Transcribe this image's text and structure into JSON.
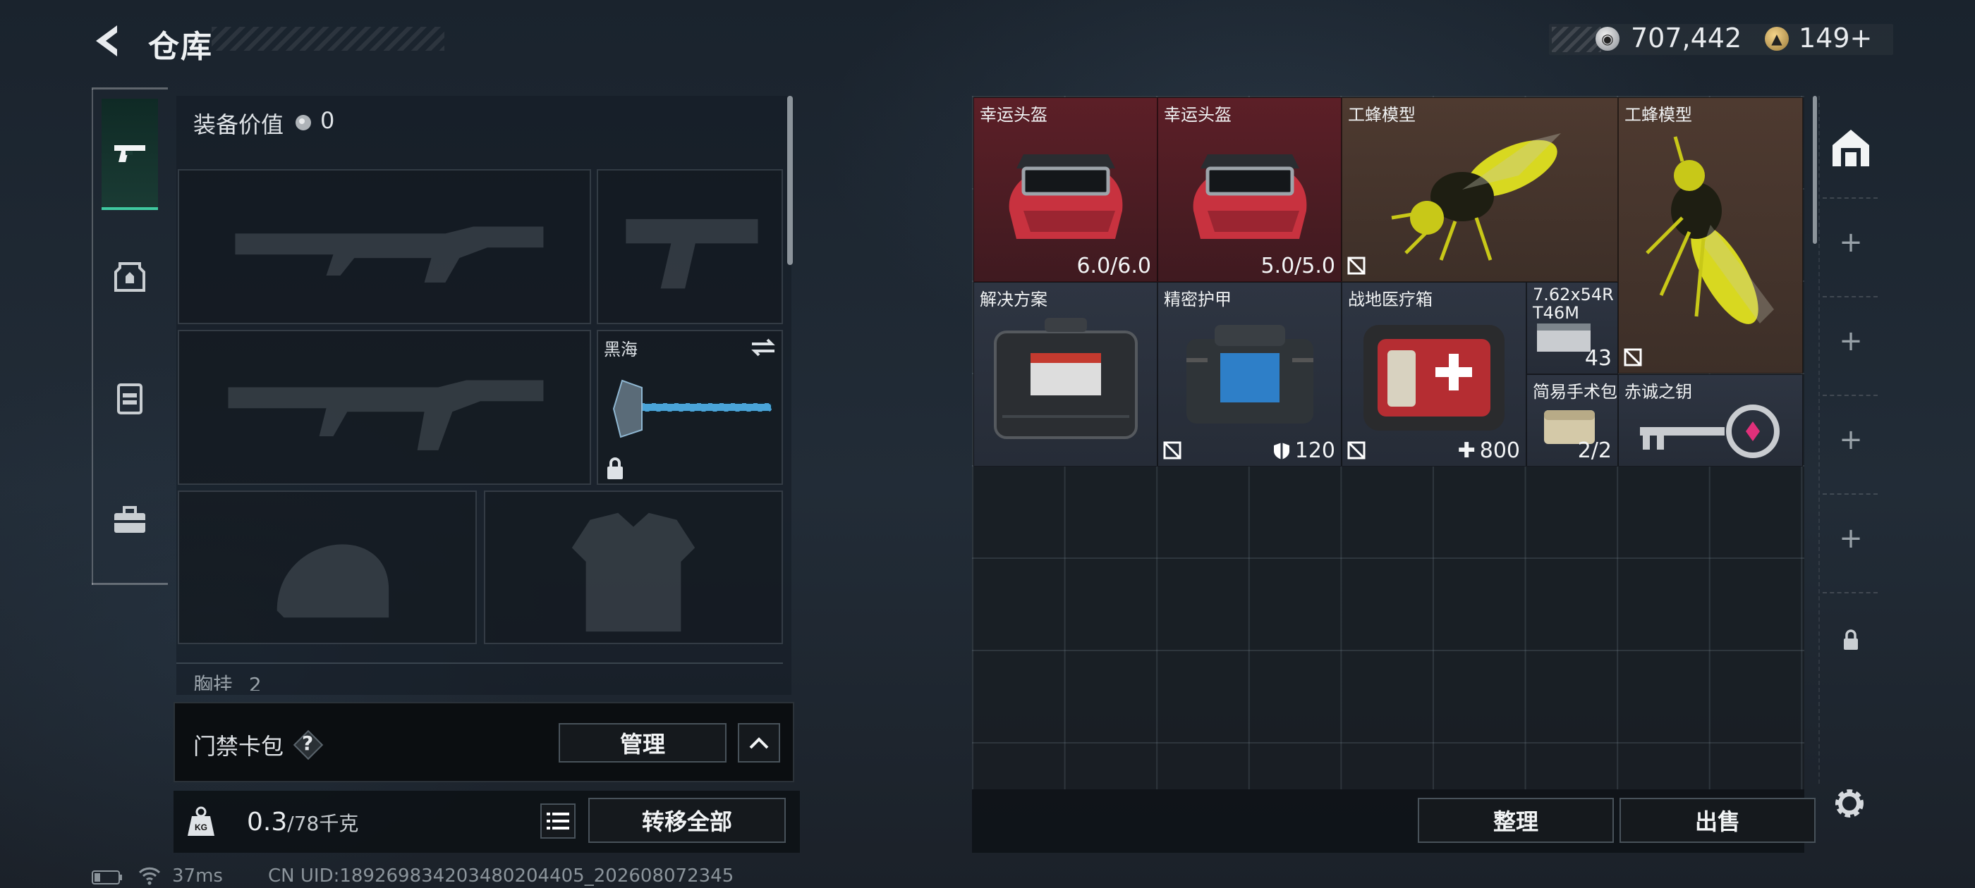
{
  "header": {
    "title": "仓库",
    "silver_amount": "707,442",
    "gold_amount": "149+"
  },
  "sidebar": {
    "items": [
      "pistol-icon",
      "armor-icon",
      "backpack-icon",
      "toolbox-icon"
    ]
  },
  "equipment": {
    "value_label": "装备价值",
    "value": "0",
    "melee_slot_name": "黑海",
    "chest_label": "胸挂",
    "chest_count": "2"
  },
  "card_pack": {
    "label": "门禁卡包",
    "help": "?",
    "manage_label": "管理"
  },
  "bottom": {
    "weight_value": "0.3",
    "weight_unit": "/78千克",
    "transfer_all_label": "转移全部"
  },
  "stash": {
    "items": [
      {
        "name": "幸运头盔",
        "value": "6.0/6.0"
      },
      {
        "name": "幸运头盔",
        "value": "5.0/5.0"
      },
      {
        "name": "工蜂模型",
        "value": ""
      },
      {
        "name": "工蜂模型",
        "value": ""
      },
      {
        "name": "解决方案",
        "value": ""
      },
      {
        "name": "精密护甲",
        "value": "120"
      },
      {
        "name": "战地医疗箱",
        "value": "800"
      },
      {
        "name": "7.62x54R T46M",
        "value": "43"
      },
      {
        "name": "简易手术包",
        "value": "2/2"
      },
      {
        "name": "赤诚之钥",
        "value": ""
      }
    ],
    "sort_label": "整理",
    "sell_label": "出售"
  },
  "status": {
    "ping": "37ms",
    "uid": "CN UID:18926983420348020440​5_202608072345"
  }
}
